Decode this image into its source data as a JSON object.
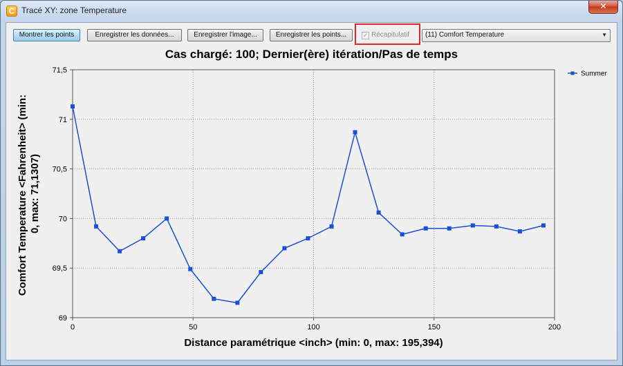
{
  "window": {
    "title": "Tracé XY: zone Temperature",
    "close_label": "✕",
    "icon_label": "C"
  },
  "toolbar": {
    "show_points": "Montrer les points",
    "save_data": "Enregistrer les données...",
    "save_image": "Enregistrer l'image...",
    "save_points": "Enregistrer les points...",
    "summary": "Récapitulatif",
    "summary_checked": true,
    "variable_select": "(11) Comfort Temperature"
  },
  "chart_data": {
    "type": "line",
    "title": "Cas chargé: 100; Dernier(ère) itération/Pas de temps",
    "xlabel": "Distance paramétrique <inch> (min: 0, max: 195,394)",
    "ylabel_lines": [
      "Comfort Temperature <Fahrenheit> (min:",
      "0, max: 71,1307)"
    ],
    "xlim": [
      0,
      200
    ],
    "ylim": [
      69,
      71.5
    ],
    "xticks": [
      0,
      50,
      100,
      150,
      200
    ],
    "xtick_labels": [
      "0",
      "50",
      "100",
      "150",
      "200"
    ],
    "yticks": [
      69,
      69.5,
      70,
      70.5,
      71,
      71.5
    ],
    "ytick_labels": [
      "69",
      "69,5",
      "70",
      "70,5",
      "71",
      "71,5"
    ],
    "grid": true,
    "legend_position": "top-right",
    "series_color": "#1a4fd6",
    "series": [
      {
        "name": "Summer",
        "x": [
          0,
          9.77,
          19.54,
          29.31,
          39.08,
          48.85,
          58.62,
          68.39,
          78.15,
          87.92,
          97.69,
          107.46,
          117.23,
          127.0,
          136.77,
          146.54,
          156.31,
          166.08,
          175.85,
          185.62,
          195.39
        ],
        "y": [
          71.13,
          69.92,
          69.67,
          69.8,
          70.0,
          69.49,
          69.19,
          69.15,
          69.46,
          69.7,
          69.8,
          69.92,
          70.87,
          70.06,
          69.84,
          69.9,
          69.9,
          69.93,
          69.92,
          69.87,
          69.93
        ]
      }
    ]
  }
}
